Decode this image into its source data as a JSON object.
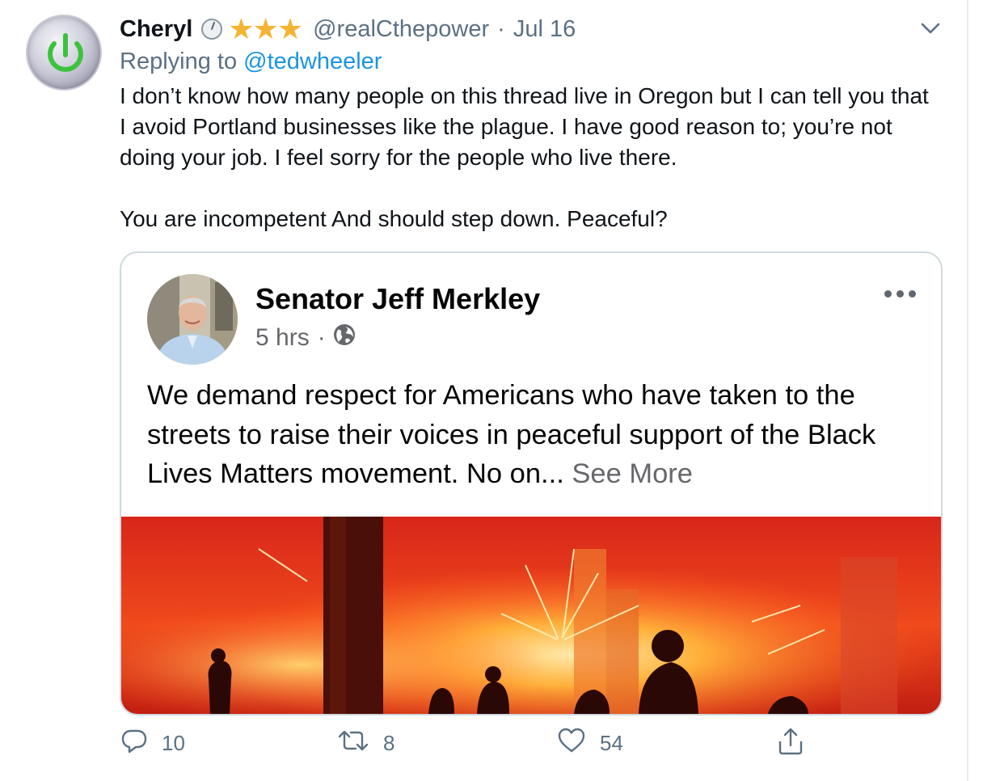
{
  "tweet": {
    "author_name": "Cheryl",
    "author_handle": "@realCthepower",
    "separator": "·",
    "date": "Jul 16",
    "replying_prefix": "Replying to",
    "replying_to": "@tedwheeler",
    "body_paragraph_1": "I don’t know how many people on this thread live in Oregon but I can tell you that I avoid Portland businesses like the plague. I have good reason to; you’re not doing your job. I feel sorry for the people who live there.",
    "body_paragraph_2": "You are incompetent And should step down. Peaceful?",
    "name_icons": [
      "clock-icon",
      "star-icon",
      "star-icon",
      "star-icon"
    ],
    "star_color": "#f4b433",
    "link_color": "#1b95e0",
    "muted_color": "#5b7083"
  },
  "embedded_post": {
    "author": "Senator Jeff Merkley",
    "time": "5 hrs",
    "meta_separator": "·",
    "audience_icon": "globe-icon",
    "text": "We demand respect for Americans who have taken to the streets to raise their voices in peaceful support of the Black Lives Matters movement. No on...",
    "see_more": "See More"
  },
  "actions": {
    "reply_count": "10",
    "retweet_count": "8",
    "like_count": "54",
    "icons": [
      "reply-icon",
      "retweet-icon",
      "like-icon",
      "share-icon"
    ]
  }
}
